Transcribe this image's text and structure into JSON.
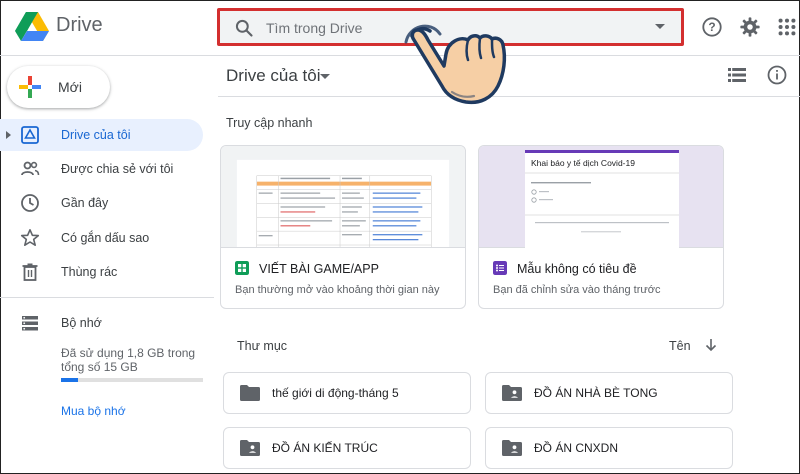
{
  "app": {
    "title": "Drive"
  },
  "search": {
    "placeholder": "Tìm trong Drive"
  },
  "colors": {
    "accent": "#1a73e8",
    "highlight": "#d32f2f",
    "sheets": "#0f9d58",
    "forms": "#673ab7"
  },
  "sidebar": {
    "new_label": "Mới",
    "items": [
      {
        "label": "Drive của tôi",
        "icon": "my-drive-icon",
        "active": true
      },
      {
        "label": "Được chia sẻ với tôi",
        "icon": "shared-icon"
      },
      {
        "label": "Gần đây",
        "icon": "recent-icon"
      },
      {
        "label": "Có gắn dấu sao",
        "icon": "starred-icon"
      },
      {
        "label": "Thùng rác",
        "icon": "trash-icon"
      }
    ],
    "storage": {
      "label": "Bộ nhớ",
      "usage": "Đã sử dụng 1,8 GB trong tổng số 15 GB",
      "used_fraction": 0.12,
      "buy_label": "Mua bộ nhớ"
    }
  },
  "main": {
    "title": "Drive của tôi",
    "quick_access": {
      "label": "Truy cập nhanh",
      "cards": [
        {
          "name": "VIẾT BÀI GAME/APP",
          "subtitle": "Bạn thường mở vào khoảng thời gian này",
          "type": "sheets"
        },
        {
          "name": "Mẫu không có tiêu đề",
          "subtitle": "Bạn đã chỉnh sửa vào tháng trước",
          "type": "forms",
          "preview_title": "Khai báo y tế dịch Covid-19"
        }
      ]
    },
    "folders": {
      "label": "Thư mục",
      "sort_label": "Tên",
      "items": [
        {
          "name": "thế giới di động-tháng 5",
          "shared": false
        },
        {
          "name": "ĐỒ ÁN NHÀ BÈ TONG",
          "shared": true
        },
        {
          "name": "ĐỒ ÁN KIẾN TRÚC",
          "shared": true
        },
        {
          "name": "ĐỒ ÁN CNXDN",
          "shared": true
        }
      ]
    }
  }
}
